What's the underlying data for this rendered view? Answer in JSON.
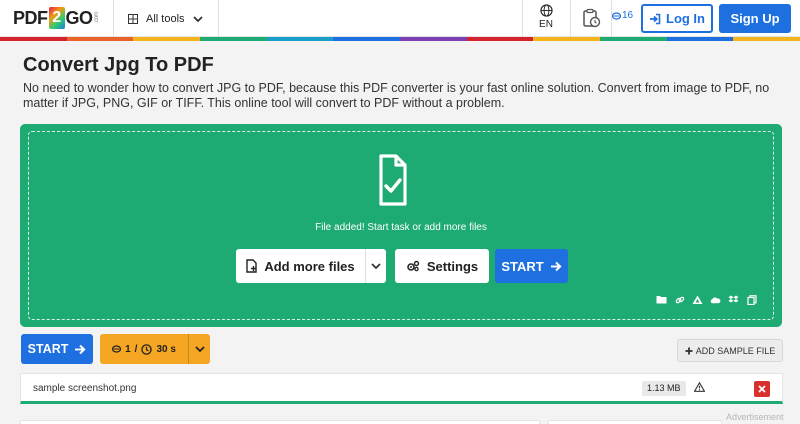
{
  "header": {
    "logo": {
      "pre": "PDF",
      "mid": "2",
      "post": "GO",
      "suffix": ".com"
    },
    "all_tools_label": "All tools",
    "language_label": "EN",
    "credits_count": "16",
    "login_label": "Log In",
    "signup_label": "Sign Up",
    "rainbow_colors": [
      "#d6212e",
      "#e8622a",
      "#f3b41b",
      "#1eaa73",
      "#1aa0c8",
      "#1e6fe0",
      "#7b3fb4",
      "#d6212e",
      "#f3b41b",
      "#1eaa73",
      "#1e6fe0",
      "#f3b41b"
    ]
  },
  "page": {
    "title": "Convert Jpg To PDF",
    "description": "No need to wonder how to convert JPG to PDF, because this PDF converter is your fast online solution. Convert from image to PDF, no matter if JPG, PNG, GIF or TIFF. This online tool will convert to PDF without a problem."
  },
  "dropzone": {
    "background_color": "#1eaa73",
    "icon": "file-check-icon",
    "message": "File added! Start task or add more files",
    "add_files_label": "Add more files",
    "settings_label": "Settings",
    "start_label": "START",
    "sources": [
      "folder-icon",
      "link-icon",
      "google-drive-icon",
      "onedrive-icon",
      "dropbox-icon",
      "copy-icon"
    ]
  },
  "toolbar": {
    "start_label": "START",
    "credits_used": "1",
    "separator": "/",
    "time_estimate": "30 s",
    "add_sample_label": "ADD SAMPLE FILE"
  },
  "files": [
    {
      "name": "sample screenshot.png",
      "size": "1.13 MB"
    }
  ],
  "footer": {
    "advertisement_label": "Advertisement"
  },
  "colors": {
    "primary": "#1e6fe0",
    "success": "#1eaa73",
    "warning": "#f5a623",
    "danger": "#d9302c"
  }
}
